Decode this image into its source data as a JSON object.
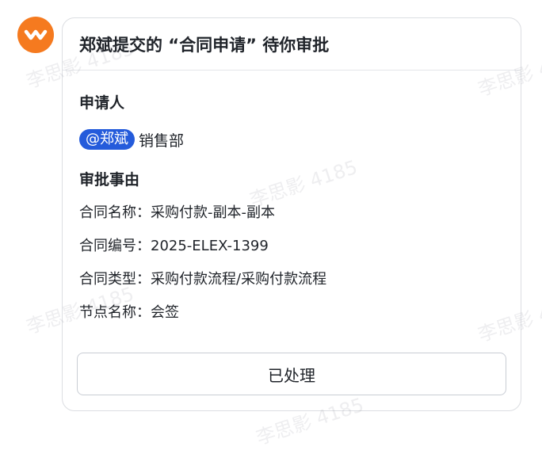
{
  "header": {
    "title": "郑斌提交的 “合同申请” 待你审批"
  },
  "applicant": {
    "section_title": "申请人",
    "mention": "@郑斌",
    "department": "销售部"
  },
  "reason": {
    "section_title": "审批事由",
    "fields": [
      {
        "label": "合同名称：",
        "value": "采购付款-副本-副本"
      },
      {
        "label": "合同编号：",
        "value": "2025-ELEX-1399"
      },
      {
        "label": "合同类型：",
        "value": "采购付款流程/采购付款流程"
      },
      {
        "label": "节点名称：",
        "value": "会签"
      }
    ]
  },
  "action": {
    "button_label": "已处理"
  },
  "watermark": {
    "text": "李思影 4185"
  },
  "colors": {
    "logo_bg": "#f57a1f",
    "mention_bg": "#245bdb"
  },
  "icons": {
    "app_logo": "app-logo-icon"
  }
}
